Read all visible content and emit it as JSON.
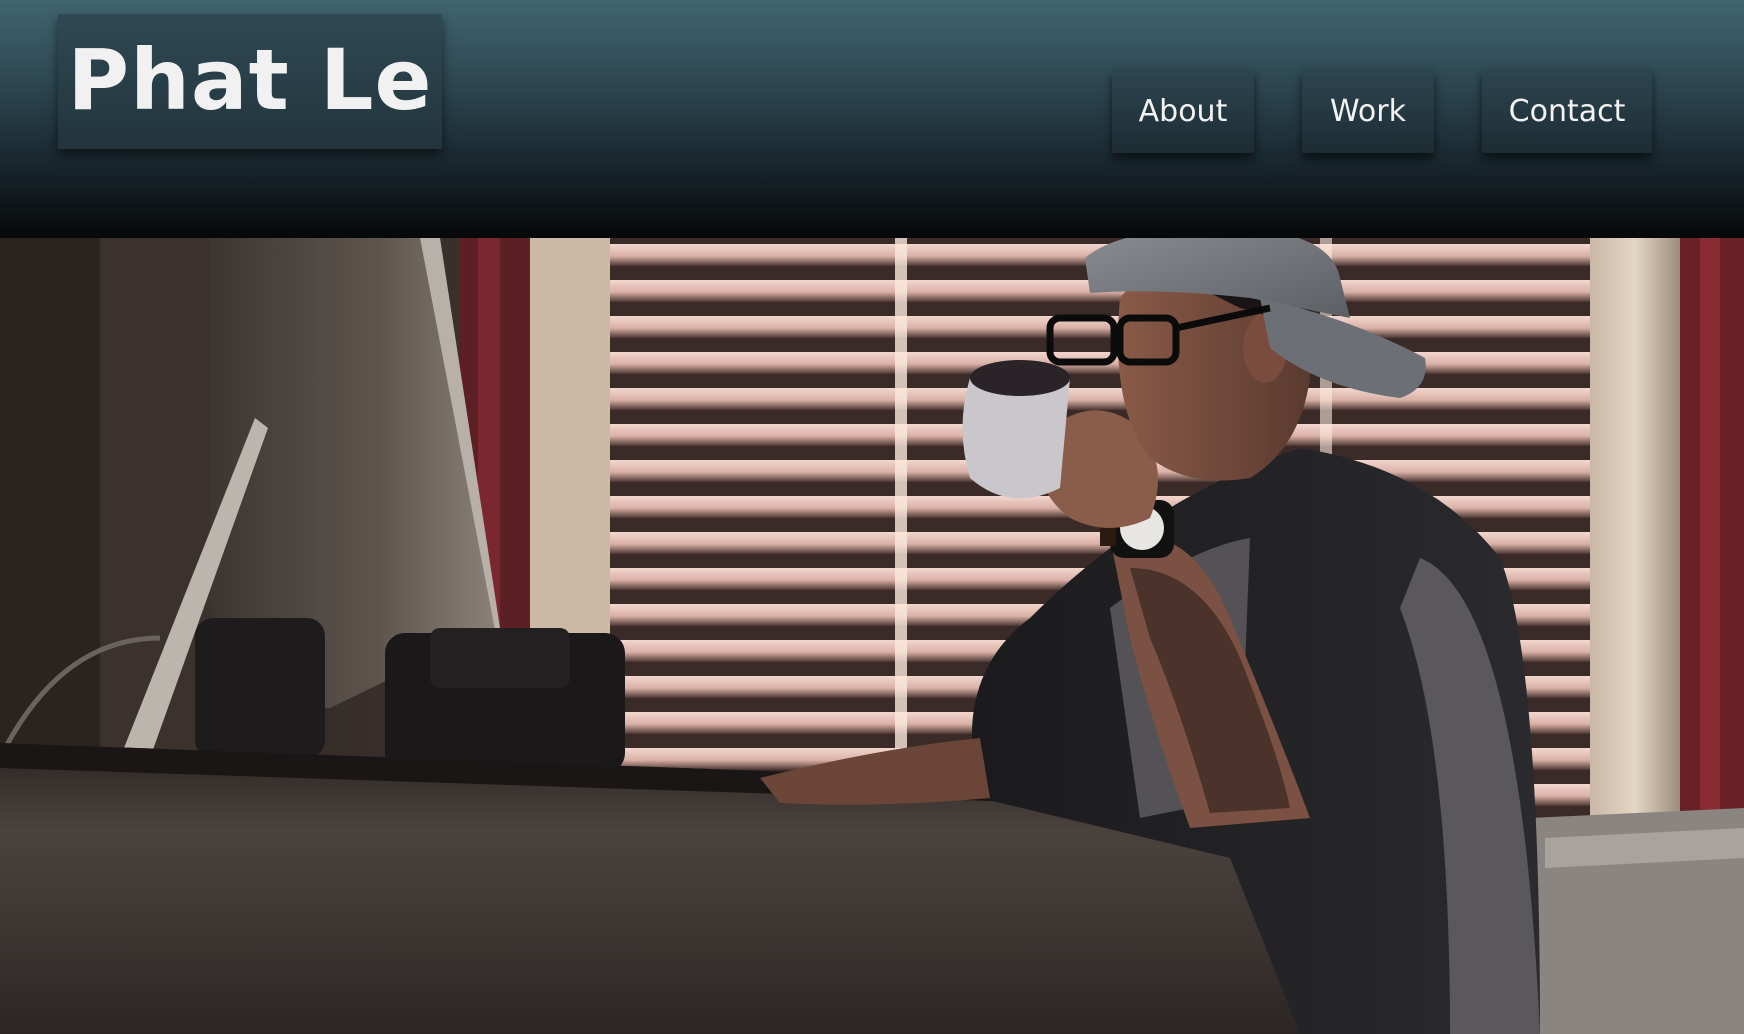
{
  "header": {
    "site_title": "Phat Le",
    "nav": {
      "about_label": "About",
      "work_label": "Work",
      "contact_label": "Contact"
    }
  },
  "hero": {
    "image_alt": "Man in a backwards cap drinking from a mug at a desk in front of window blinds"
  },
  "colors": {
    "header_top": "#416571",
    "header_bottom": "#060809",
    "button_bg": "#22343c",
    "text": "#f1f1f1"
  }
}
